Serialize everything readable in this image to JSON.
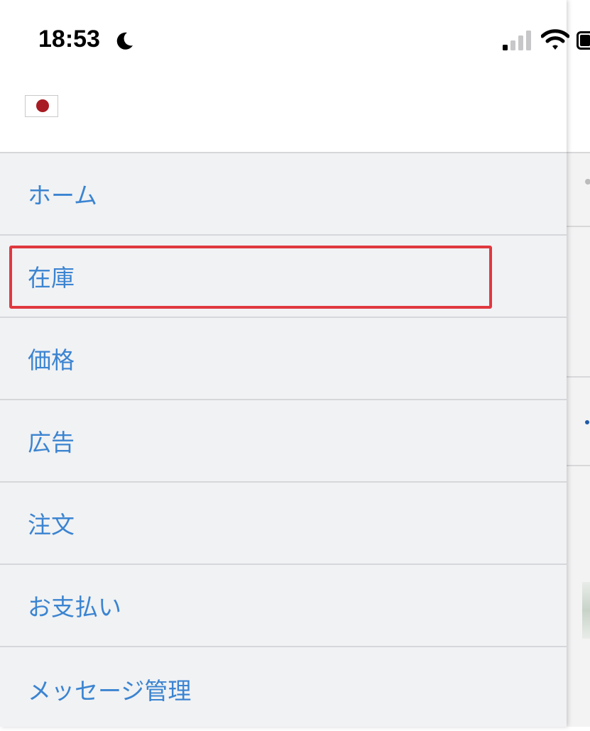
{
  "status_bar": {
    "time": "18:53",
    "icons": [
      "moon-icon",
      "cellular-signal-icon",
      "wifi-icon",
      "battery-icon"
    ]
  },
  "header": {
    "flag": "japan-flag-icon"
  },
  "menu": {
    "items": [
      {
        "label": "ホーム"
      },
      {
        "label": "在庫"
      },
      {
        "label": "価格"
      },
      {
        "label": "広告"
      },
      {
        "label": "注文"
      },
      {
        "label": "お支払い"
      },
      {
        "label": "メッセージ管理"
      }
    ],
    "highlighted_index": 1
  },
  "colors": {
    "menu_text": "#3b84d1",
    "highlight": "#e0393f",
    "drawer_bg": "#f1f2f4",
    "flag_red": "#a81b22"
  }
}
